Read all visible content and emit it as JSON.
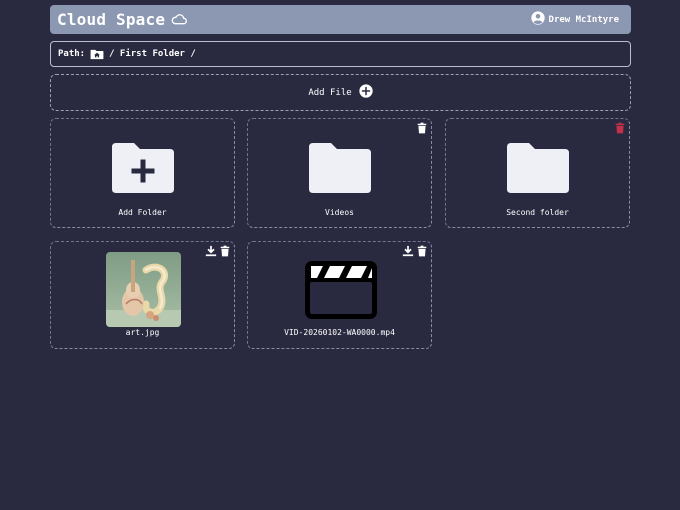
{
  "app": {
    "title": "Cloud Space",
    "user_name": "Drew McIntyre"
  },
  "path": {
    "label": "Path:",
    "trail": "/ First Folder /"
  },
  "add_file": {
    "label": "Add File"
  },
  "folders": [
    {
      "name": "Add Folder"
    },
    {
      "name": "Videos"
    },
    {
      "name": "Second folder"
    }
  ],
  "files": [
    {
      "name": "art.jpg"
    },
    {
      "name": "VID-20260102-WA0000.mp4"
    }
  ],
  "colors": {
    "background": "#292a40",
    "header": "#8c97b2",
    "folder": "#eef0f6",
    "delete_active": "#c4304a"
  }
}
